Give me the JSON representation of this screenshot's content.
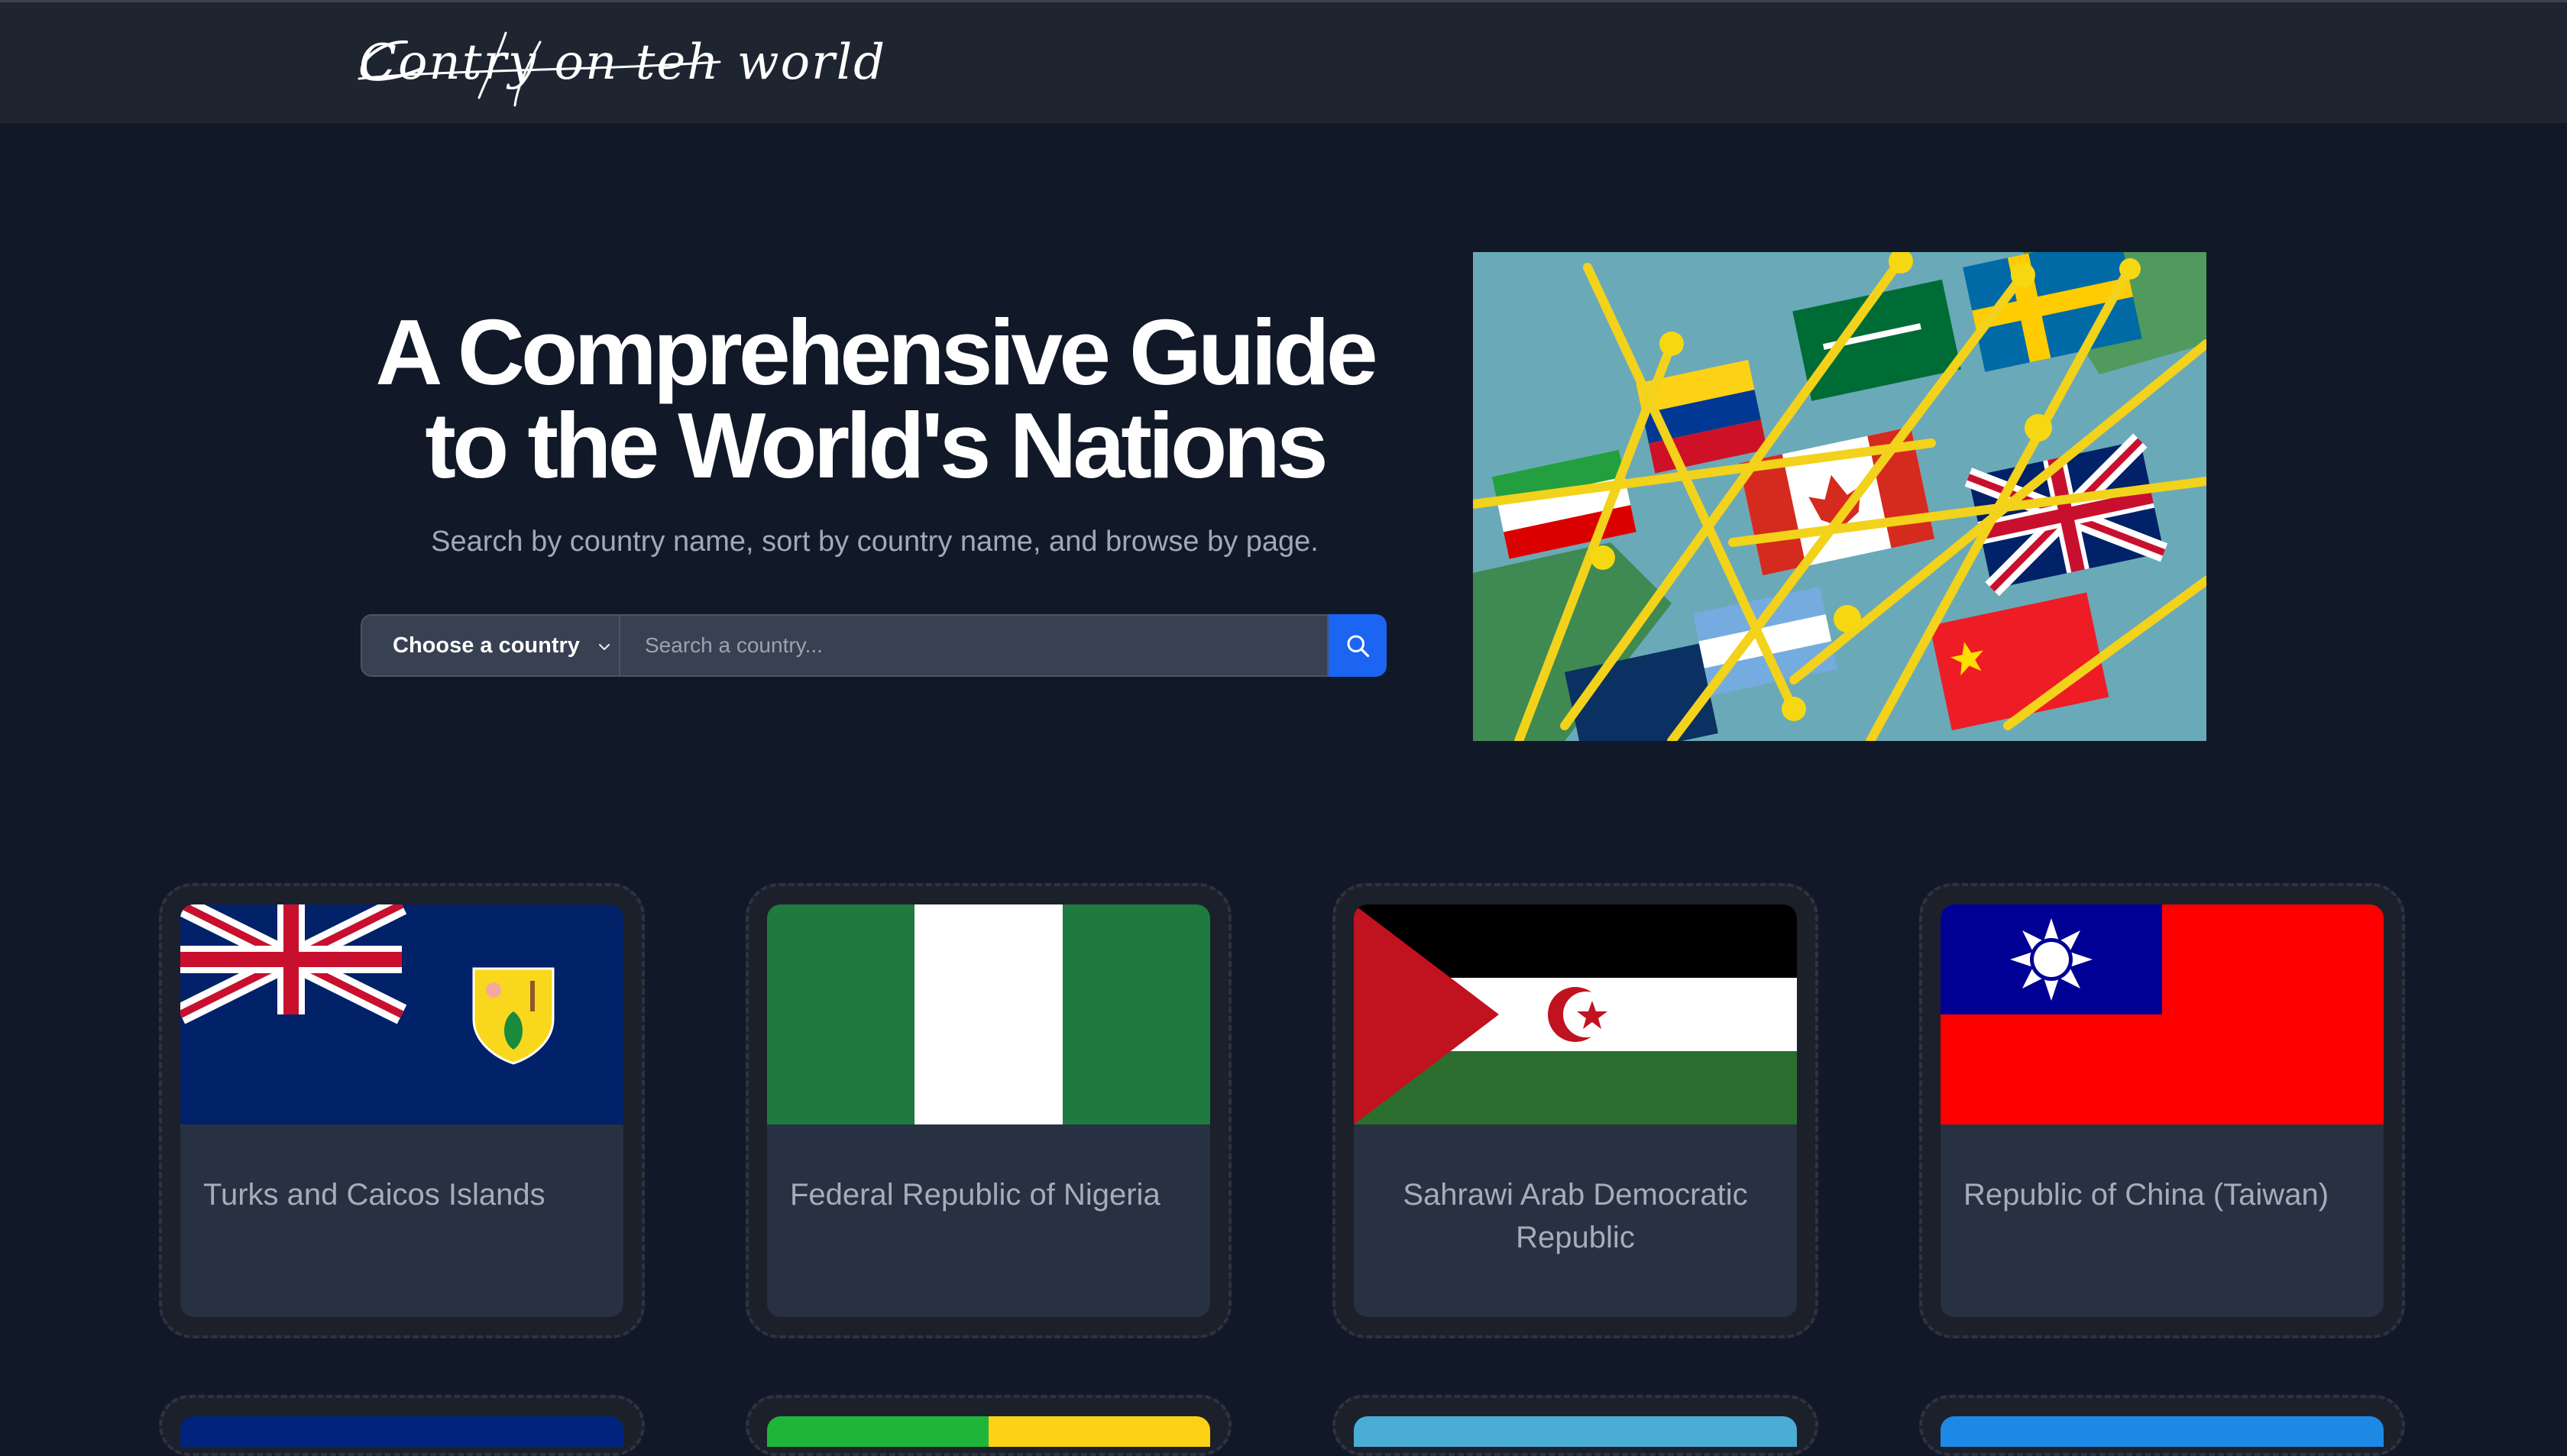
{
  "navbar": {
    "logo_text": "Contry on teh world"
  },
  "hero": {
    "title_line1": "A Comprehensive Guide",
    "title_line2": "to the World's Nations",
    "subtitle": "Search by country name, sort by country name, and browse by page."
  },
  "search": {
    "select_label": "Choose a country",
    "placeholder": "Search a country...",
    "value": ""
  },
  "countries": [
    {
      "name": "Turks and Caicos Islands",
      "flag": "turks-and-caicos-flag"
    },
    {
      "name": "Federal Republic of Nigeria",
      "flag": "nigeria-flag"
    },
    {
      "name": "Sahrawi Arab Democratic Republic",
      "flag": "sahrawi-flag"
    },
    {
      "name": "Republic of China (Taiwan)",
      "flag": "taiwan-flag"
    }
  ],
  "colors": {
    "background": "#111827",
    "navbar": "#1f2530",
    "card": "#283141",
    "accent": "#1c64f2"
  }
}
